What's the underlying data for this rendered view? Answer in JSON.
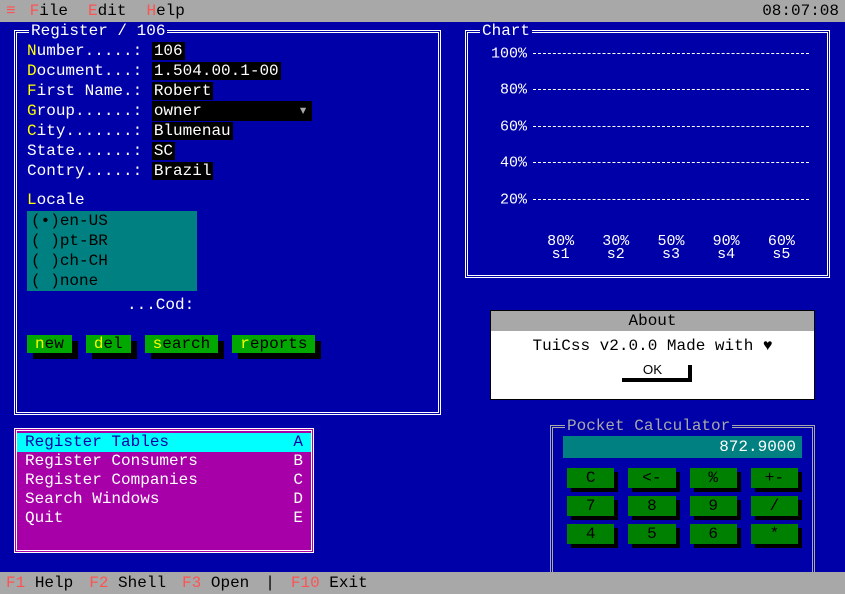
{
  "menubar": {
    "file": "File",
    "edit": "Edit",
    "help": "Help",
    "clock": "08:07:08"
  },
  "statusbar": {
    "f1": "Help",
    "f2": "Shell",
    "f3": "Open",
    "f10": "Exit"
  },
  "register": {
    "title": "Register / 106",
    "fields": {
      "number_label": "Number.....:",
      "number": "106",
      "document_label": "Document...:",
      "document": "1.504.00.1-00",
      "firstname_label": "First Name.:",
      "firstname": "Robert",
      "group_label": "Group......:",
      "group": "owner",
      "city_label": "City.......:",
      "city": "Blumenau",
      "state_label": "State......:",
      "state": "SC",
      "country_label": "Contry.....:",
      "country": "Brazil"
    },
    "locale_label": "Locale",
    "locales": [
      "en-US",
      "pt-BR",
      "ch-CH",
      "none"
    ],
    "cod_label": "...Cod:",
    "buttons": {
      "new": "new",
      "del": "del",
      "search": "search",
      "reports": "reports"
    }
  },
  "chart": {
    "title": "Chart"
  },
  "chart_data": {
    "type": "bar",
    "categories": [
      "s1",
      "s2",
      "s3",
      "s4",
      "s5"
    ],
    "values": [
      80,
      30,
      50,
      90,
      60
    ],
    "value_labels": [
      "80%",
      "30%",
      "50%",
      "90%",
      "60%"
    ],
    "colors": [
      "#a80000",
      "#00a800",
      "#0000fc",
      "#a8a800",
      "#a800a8"
    ],
    "y_ticks": [
      20,
      40,
      60,
      80,
      100
    ],
    "ylim": [
      0,
      100
    ],
    "title": "",
    "xlabel": "",
    "ylabel": ""
  },
  "about": {
    "title": "About",
    "body": "TuiCss v2.0.0 Made with ♥",
    "ok": "OK"
  },
  "menuwin": {
    "items": [
      {
        "label": "Register Tables",
        "key": "A",
        "selected": true
      },
      {
        "label": "Register Consumers",
        "key": "B",
        "selected": false
      },
      {
        "label": "Register Companies",
        "key": "C",
        "selected": false
      },
      {
        "label": "Search Windows",
        "key": "D",
        "selected": false
      },
      {
        "label": "Quit",
        "key": "E",
        "selected": false
      }
    ]
  },
  "calc": {
    "title": "Pocket Calculator",
    "display": "872.9000",
    "keys_row1": [
      "C",
      "<-",
      "%",
      "+-"
    ],
    "keys_row2": [
      "7",
      "8",
      "9",
      "/"
    ],
    "keys_row3": [
      "4",
      "5",
      "6",
      "*"
    ]
  }
}
